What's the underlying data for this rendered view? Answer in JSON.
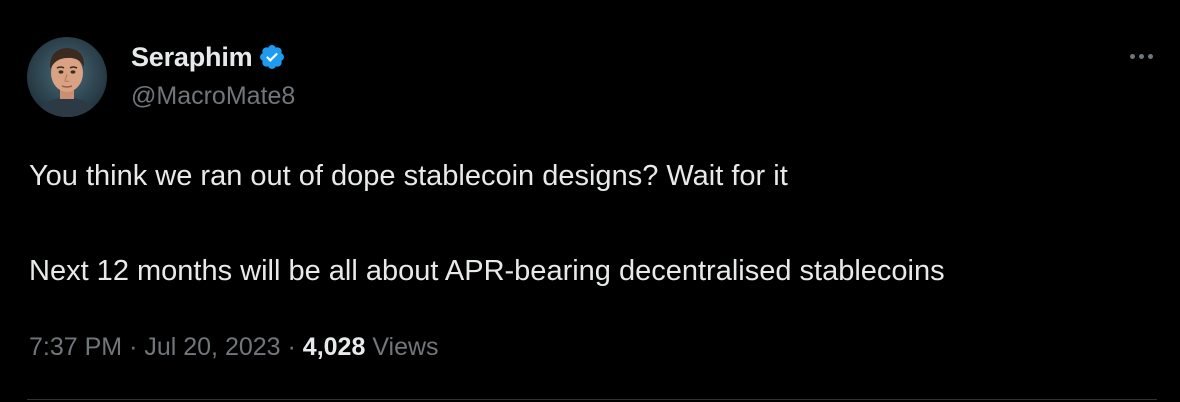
{
  "author": {
    "display_name": "Seraphim",
    "handle": "@MacroMate8",
    "verified": true,
    "avatar_icon": "profile-photo"
  },
  "tweet": {
    "lines": [
      "You think we ran out of dope stablecoin designs? Wait for it",
      "Next 12 months will be all about APR-bearing decentralised stablecoins"
    ]
  },
  "meta": {
    "time": "7:37 PM",
    "date": "Jul 20, 2023",
    "separator": "·",
    "views_count": "4,028",
    "views_label": "Views"
  },
  "colors": {
    "background": "#000000",
    "text_primary": "#e7e9ea",
    "text_secondary": "#71767b",
    "verified_badge": "#1d9bf0",
    "divider": "#2f3336"
  },
  "icons": {
    "verified": "verified-badge-icon",
    "more": "more-options-icon"
  }
}
